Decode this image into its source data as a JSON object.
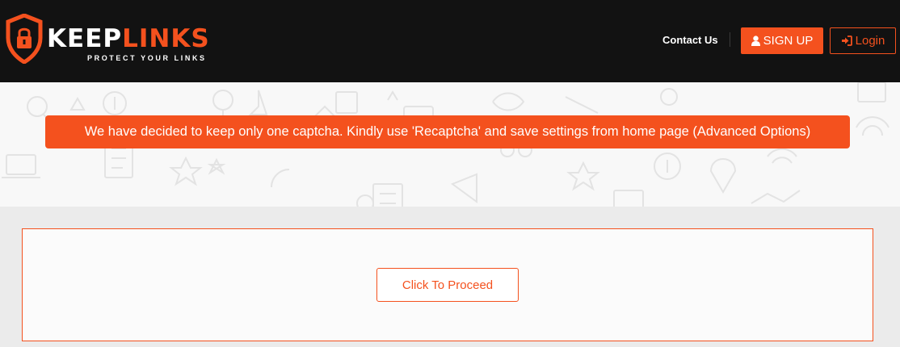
{
  "header": {
    "logo": {
      "word_keep": "KEEP",
      "word_links": "LINKS",
      "tagline": "PROTECT YOUR LINKS"
    },
    "nav": {
      "contact_label": "Contact Us",
      "signup_label": "SIGN UP",
      "login_label": "Login"
    }
  },
  "notice": {
    "text": "We have decided to keep only one captcha. Kindly use 'Recaptcha' and save settings from home page (Advanced Options)"
  },
  "main": {
    "proceed_label": "Click To Proceed"
  },
  "colors": {
    "accent": "#f4511e",
    "header_bg": "#121212",
    "band_bg": "#ebebeb"
  },
  "icons": [
    "shield-lock-icon",
    "user-icon",
    "sign-in-icon"
  ]
}
